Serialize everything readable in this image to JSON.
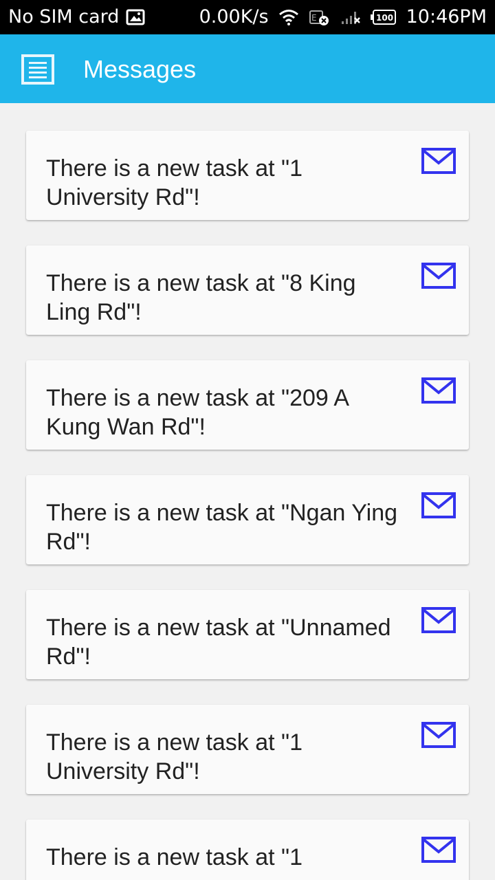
{
  "status_bar": {
    "carrier": "No SIM card",
    "speed": "0.00K/s",
    "battery": "100",
    "time": "10:46PM"
  },
  "app_bar": {
    "title": "Messages",
    "menu_icon": "menu-icon"
  },
  "messages": [
    {
      "text": "There is a new task at \"1 University Rd\"!",
      "icon": "mail-icon"
    },
    {
      "text": "There is a new task at \"8 King Ling Rd\"!",
      "icon": "mail-icon"
    },
    {
      "text": "There is a new task at \"209 A Kung Wan Rd\"!",
      "icon": "mail-icon"
    },
    {
      "text": "There is a new task at \"Ngan Ying Rd\"!",
      "icon": "mail-icon"
    },
    {
      "text": "There is a new task at \"Unnamed Rd\"!",
      "icon": "mail-icon"
    },
    {
      "text": "There is a new task at \"1 University Rd\"!",
      "icon": "mail-icon"
    },
    {
      "text": "There is a new task at \"1",
      "icon": "mail-icon"
    }
  ],
  "colors": {
    "app_bar": "#1fb5ea",
    "mail_icon": "#3333ee",
    "background": "#f1f1f1"
  }
}
